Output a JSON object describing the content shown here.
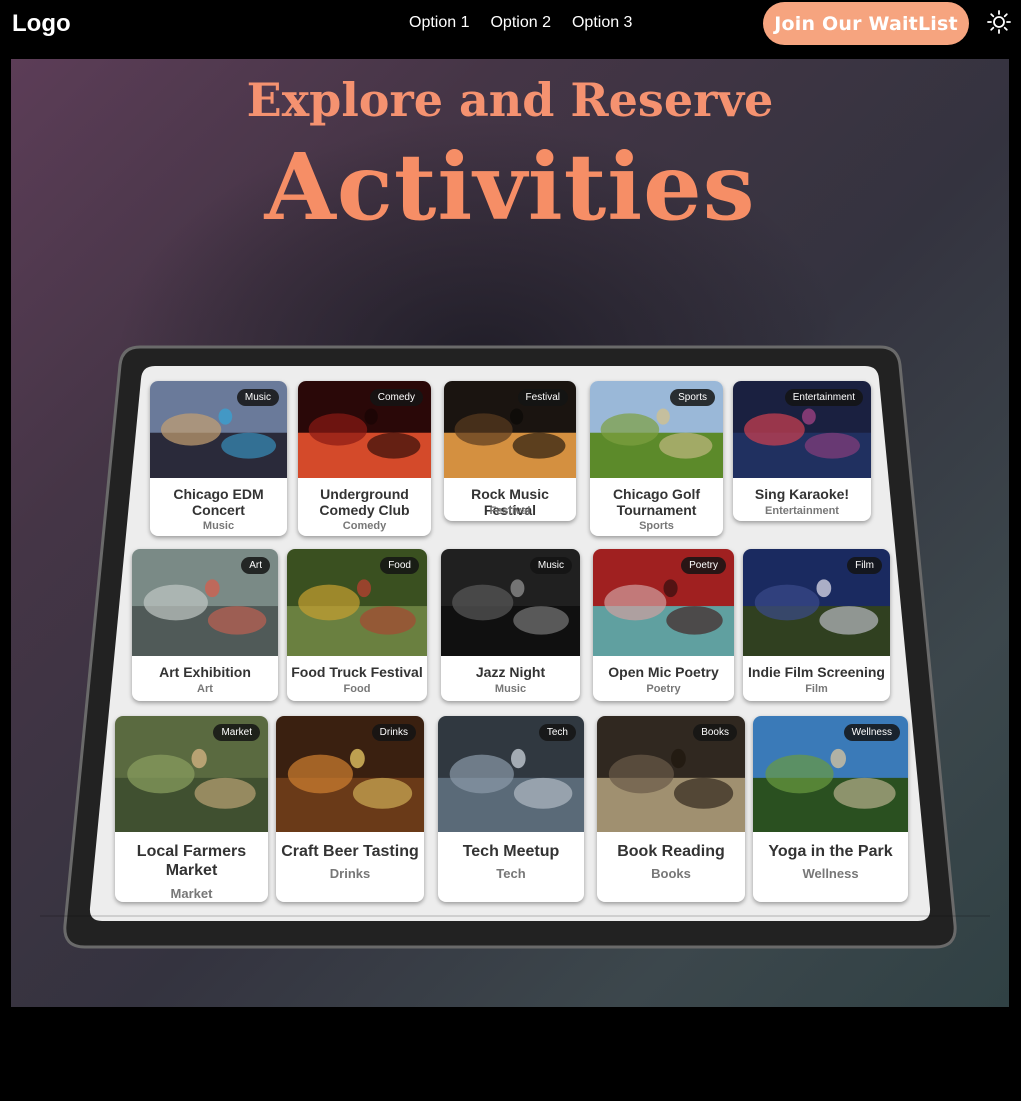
{
  "nav": {
    "logo": "Logo",
    "links": [
      "Option 1",
      "Option 2",
      "Option 3"
    ],
    "cta": "Join Our WaitList",
    "theme_icon": "sun-icon"
  },
  "hero": {
    "subtitle": "Explore and Reserve",
    "title": "Activities"
  },
  "activities": [
    {
      "title": "Chicago EDM Concert",
      "category": "Music",
      "badge": "Music"
    },
    {
      "title": "Underground Comedy Club",
      "category": "Comedy",
      "badge": "Comedy"
    },
    {
      "title": "Rock Music Festival",
      "category": "Festival",
      "badge": "Festival"
    },
    {
      "title": "Chicago Golf Tournament",
      "category": "Sports",
      "badge": "Sports"
    },
    {
      "title": "Sing Karaoke!",
      "category": "Entertainment",
      "badge": "Entertainment"
    },
    {
      "title": "Art Exhibition",
      "category": "Art",
      "badge": "Art"
    },
    {
      "title": "Food Truck Festival",
      "category": "Food",
      "badge": "Food"
    },
    {
      "title": "Jazz Night",
      "category": "Music",
      "badge": "Music"
    },
    {
      "title": "Open Mic Poetry",
      "category": "Poetry",
      "badge": "Poetry"
    },
    {
      "title": "Indie Film Screening",
      "category": "Film",
      "badge": "Film"
    },
    {
      "title": "Local Farmers Market",
      "category": "Market",
      "badge": "Market"
    },
    {
      "title": "Craft Beer Tasting",
      "category": "Drinks",
      "badge": "Drinks"
    },
    {
      "title": "Tech Meetup",
      "category": "Tech",
      "badge": "Tech"
    },
    {
      "title": "Book Reading",
      "category": "Books",
      "badge": "Books"
    },
    {
      "title": "Yoga in the Park",
      "category": "Wellness",
      "badge": "Wellness"
    }
  ],
  "colors": {
    "accent": "#f68e66",
    "button": "#f6a47f"
  }
}
